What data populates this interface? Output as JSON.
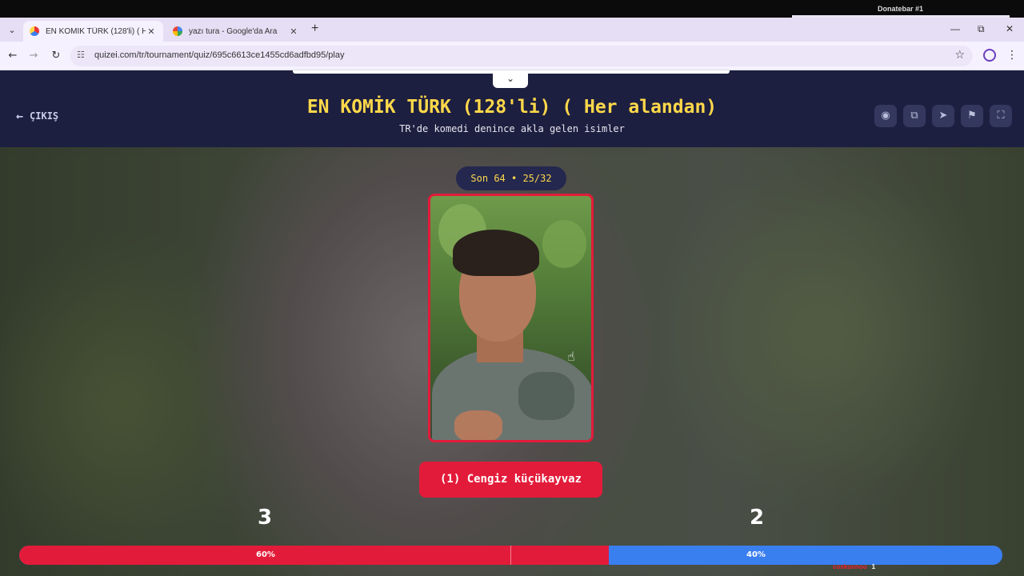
{
  "overlay": {
    "donate_label": "Donatebar #1"
  },
  "browser": {
    "tabs": [
      {
        "title": "EN KOMİK TÜRK (128'li) ( Her al",
        "active": true
      },
      {
        "title": "yazı tura - Google'da Ara",
        "active": false
      }
    ],
    "new_tab": "+",
    "window_controls": {
      "minimize": "—",
      "restore": "⧉",
      "close": "✕"
    },
    "url": "quizei.com/tr/tournament/quiz/695c6613ce1455cd6adfbd95/play"
  },
  "header": {
    "exit_label": "ÇIKIŞ",
    "title": "EN KOMİK TÜRK (128'li) ( Her alandan)",
    "subtitle": "TR'de komedi denince akla gelen isimler",
    "tools": [
      "eye-icon",
      "share-icon",
      "send-icon",
      "flag-icon",
      "fullscreen-icon"
    ]
  },
  "match": {
    "round_label": "Son 64 • 25/32",
    "current_name": "(1) Cengiz küçükayvaz",
    "left_count": "3",
    "right_count": "2",
    "left_percent_label": "60%",
    "right_percent_label": "40%",
    "left_percent": 60,
    "right_percent": 40
  },
  "stream": {
    "user": "coskunnoo",
    "value": "1"
  },
  "colors": {
    "accent_red": "#e31b3a",
    "accent_blue": "#3a7ff0",
    "title_yellow": "#ffd84a",
    "header_navy": "#1d1f40"
  }
}
